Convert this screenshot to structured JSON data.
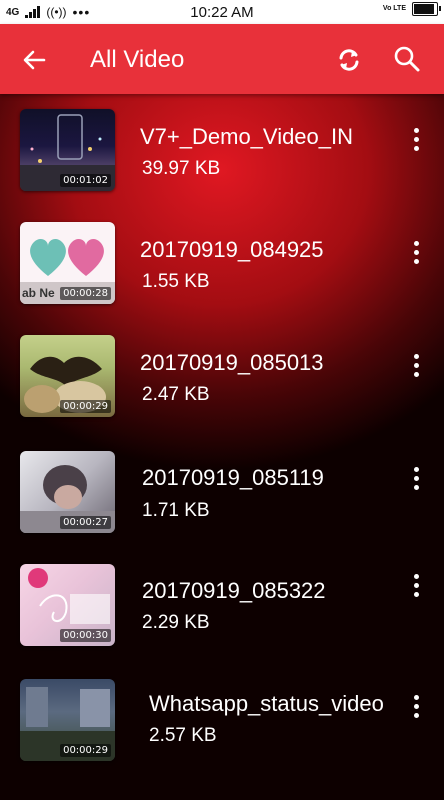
{
  "status_bar": {
    "network": "4G",
    "time": "10:22 AM",
    "volte": "Vo LTE"
  },
  "app_bar": {
    "title": "All Video",
    "back_icon": "arrow-back-icon",
    "refresh_icon": "refresh-icon",
    "search_icon": "search-icon"
  },
  "videos": [
    {
      "name": "V7+_Demo_Video_IN",
      "size": "39.97 KB",
      "duration": "00:01:02"
    },
    {
      "name": "20170919_084925",
      "size": "1.55 KB",
      "duration": "00:00:28",
      "overlay_text": "ab Ne"
    },
    {
      "name": "20170919_085013",
      "size": "2.47 KB",
      "duration": "00:00:29"
    },
    {
      "name": "20170919_085119",
      "size": "1.71 KB",
      "duration": "00:00:27"
    },
    {
      "name": "20170919_085322",
      "size": "2.29 KB",
      "duration": "00:00:30"
    },
    {
      "name": "Whatsapp_status_video",
      "size": "2.57 KB",
      "duration": "00:00:29"
    }
  ],
  "colors": {
    "app_bar": "#e8313a",
    "background_center": "#e01822",
    "background_edge": "#0d0000"
  }
}
